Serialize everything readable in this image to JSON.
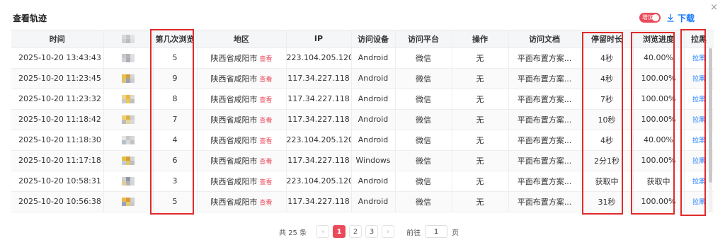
{
  "dialog": {
    "title": "查看轨迹",
    "close_icon": "×",
    "toggle_label": "增加",
    "download_label": "下载"
  },
  "colors": {
    "accent": "#ea4a5a",
    "link": "#1677ff",
    "highlight_box": "#e02b2b"
  },
  "table": {
    "columns": [
      "时间",
      "",
      "第几次浏览",
      "地区",
      "IP",
      "访问设备",
      "访问平台",
      "操作",
      "访问文档",
      "停留时长",
      "浏览进度",
      "拉黑"
    ],
    "view_label": "查看",
    "rows": [
      {
        "time": "2025-10-20 13:43:43",
        "visit": "5",
        "region": "陕西省咸阳市",
        "ip": "223.104.205.120",
        "device": "Android",
        "platform": "微信",
        "action": "无",
        "doc": "平面布置方案...",
        "stay": "4秒",
        "progress": "40.00%",
        "block": "拉黑"
      },
      {
        "time": "2025-10-20 11:23:45",
        "visit": "9",
        "region": "陕西省咸阳市",
        "ip": "117.34.227.118",
        "device": "Android",
        "platform": "微信",
        "action": "无",
        "doc": "平面布置方案...",
        "stay": "4秒",
        "progress": "100.00%",
        "block": "拉黑"
      },
      {
        "time": "2025-10-20 11:23:32",
        "visit": "8",
        "region": "陕西省咸阳市",
        "ip": "117.34.227.118",
        "device": "Android",
        "platform": "微信",
        "action": "无",
        "doc": "平面布置方案...",
        "stay": "7秒",
        "progress": "100.00%",
        "block": "拉黑"
      },
      {
        "time": "2025-10-20 11:18:42",
        "visit": "7",
        "region": "陕西省咸阳市",
        "ip": "117.34.227.118",
        "device": "Android",
        "platform": "微信",
        "action": "无",
        "doc": "平面布置方案...",
        "stay": "10秒",
        "progress": "100.00%",
        "block": "拉黑"
      },
      {
        "time": "2025-10-20 11:18:30",
        "visit": "4",
        "region": "陕西省咸阳市",
        "ip": "223.104.205.120",
        "device": "Android",
        "platform": "微信",
        "action": "无",
        "doc": "平面布置方案...",
        "stay": "4秒",
        "progress": "40.00%",
        "block": "拉黑"
      },
      {
        "time": "2025-10-20 11:17:18",
        "visit": "6",
        "region": "陕西省咸阳市",
        "ip": "117.34.227.118",
        "device": "Windows",
        "platform": "微信",
        "action": "无",
        "doc": "平面布置方案...",
        "stay": "2分1秒",
        "progress": "100.00%",
        "block": "拉黑"
      },
      {
        "time": "2025-10-20 10:58:31",
        "visit": "3",
        "region": "陕西省咸阳市",
        "ip": "223.104.205.120",
        "device": "Android",
        "platform": "微信",
        "action": "无",
        "doc": "平面布置方案...",
        "stay": "获取中",
        "progress": "获取中",
        "block": "拉黑"
      },
      {
        "time": "2025-10-20 10:56:38",
        "visit": "5",
        "region": "陕西省咸阳市",
        "ip": "117.34.227.118",
        "device": "Android",
        "platform": "微信",
        "action": "无",
        "doc": "平面布置方案...",
        "stay": "31秒",
        "progress": "100.00%",
        "block": "拉黑"
      }
    ]
  },
  "pagination": {
    "total": "共 25 条",
    "prev": "‹",
    "next": "›",
    "pages": [
      "1",
      "2",
      "3"
    ],
    "goto_label": "前往",
    "goto_value": "1",
    "page_unit": "页"
  }
}
